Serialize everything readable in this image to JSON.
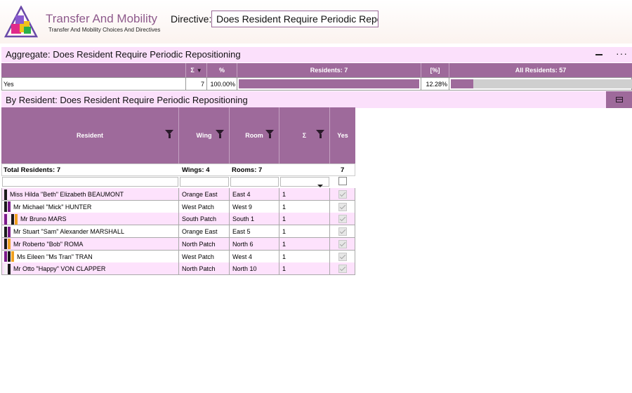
{
  "header": {
    "title": "Transfer And Mobility",
    "subtitle": "Transfer And Mobility Choices And Directives",
    "directive_label": "Directive:",
    "directive_value": "Does Resident Require Periodic Repositioning"
  },
  "aggregate": {
    "title": "Aggregate: Does Resident Require Periodic Repositioning",
    "columns": {
      "sum": "Σ",
      "percent": "%",
      "residents": "Residents: 7",
      "pct_bracket": "[%]",
      "all_residents": "All Residents: 57"
    },
    "row": {
      "label": "Yes",
      "count": "7",
      "percent": "100.00%",
      "pct_all": "12.28%",
      "residents_fraction": 1.0,
      "all_fraction": 0.1228
    }
  },
  "by_resident": {
    "title": "By Resident: Does Resident Require Periodic Repositioning",
    "columns": {
      "resident": "Resident",
      "wing": "Wing",
      "room": "Room",
      "sum": "Σ",
      "yes": "Yes"
    },
    "totals": {
      "residents": "Total Residents: 7",
      "wings": "Wings: 4",
      "rooms": "Rooms: 7",
      "yes": "7"
    },
    "rows": [
      {
        "name": "Miss Hilda \"Beth\" Elizabeth BEAUMONT",
        "wing": "Orange East",
        "room": "East  4",
        "count": "1",
        "stripes": [
          "#1a1a1a"
        ]
      },
      {
        "name": "Mr Michael \"Mick\" HUNTER",
        "wing": "West Patch",
        "room": "West  9",
        "count": "1",
        "stripes": [
          "#1a1a1a",
          "#7b1a8a"
        ]
      },
      {
        "name": "Mr Bruno MARS",
        "wing": "South Patch",
        "room": "South  1",
        "count": "1",
        "stripes": [
          "#7b1a8a",
          "#f2f2f2",
          "#1a1a1a",
          "#f0a020"
        ]
      },
      {
        "name": "Mr Stuart \"Sam\" Alexander MARSHALL",
        "wing": "Orange East",
        "room": "East  5",
        "count": "1",
        "stripes": [
          "#1a1a1a",
          "#7b1a8a"
        ]
      },
      {
        "name": "Mr Roberto \"Bob\" ROMA",
        "wing": "North Patch",
        "room": "North   6",
        "count": "1",
        "stripes": [
          "#1a1a1a",
          "#f0a020"
        ]
      },
      {
        "name": "Ms Eileen \"Ms Tran\" TRAN",
        "wing": "West Patch",
        "room": "West  4",
        "count": "1",
        "stripes": [
          "#7b1a8a",
          "#1a1a1a",
          "#f0a020"
        ]
      },
      {
        "name": "Mr  Otto \"Happy\" VON CLAPPER",
        "wing": "North Patch",
        "room": "North  10",
        "count": "1",
        "stripes": [
          "#f2f2f2",
          "#1a1a1a"
        ]
      }
    ]
  },
  "colors": {
    "accent": "#9e6a9b",
    "row_tint": "#fde2fc",
    "title": "#8e5a8c"
  }
}
